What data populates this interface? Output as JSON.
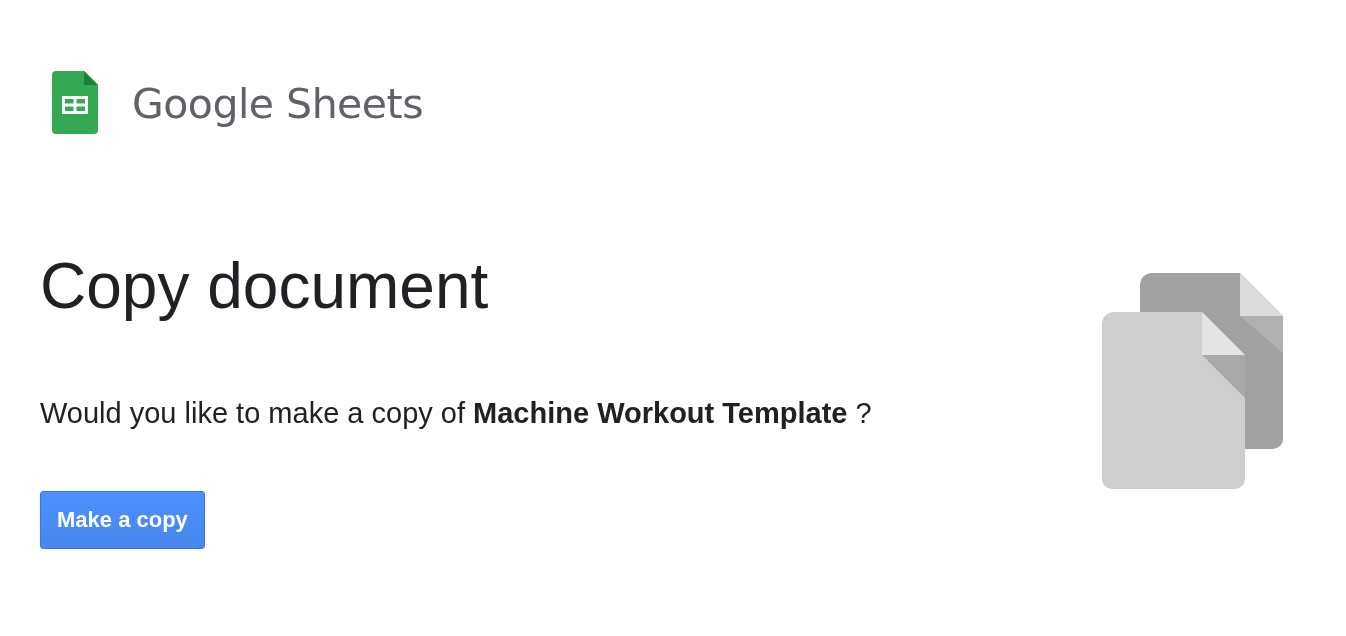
{
  "logo": {
    "product": "Google Sheets"
  },
  "heading": "Copy document",
  "prompt": "Would you like to make a copy of **Machine Workout Template** ?",
  "buttons": [
    {
      "label": "Make a copy",
      "kind": "primary"
    }
  ]
}
